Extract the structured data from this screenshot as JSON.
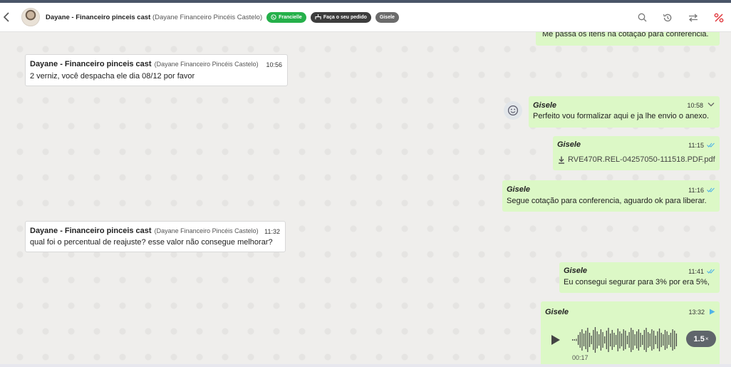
{
  "header": {
    "contact_name": "Dayane - Financeiro pinceis cast",
    "contact_sub": "(Dayane Financeiro Pincéis Castelo)",
    "tags": {
      "whatsapp": "Francielle",
      "order": "Faça o seu pedido",
      "agent": "Gisele"
    },
    "icons": [
      "search-icon",
      "history-icon",
      "transfer-icon",
      "percent-icon"
    ],
    "colors": {
      "whatsapp_tag": "#25b04a",
      "alert_icon": "#e0353b"
    }
  },
  "messages": {
    "m0": {
      "text": "Me passa os itens na cotação para conferencia."
    },
    "m1": {
      "sender": "Dayane - Financeiro pinceis cast",
      "sender_sub": "(Dayane Financeiro Pincéis Castelo)",
      "time": "10:56",
      "text": "2 verniz, você despacha ele dia 08/12 por favor"
    },
    "m2": {
      "sender": "Gisele",
      "time": "10:58",
      "text": "Perfeito vou formalizar aqui e ja lhe envio o anexo."
    },
    "m3": {
      "sender": "Gisele",
      "time": "11:15",
      "file": "RVE470R.REL-04257050-111518.PDF.pdf"
    },
    "m4": {
      "sender": "Gisele",
      "time": "11:16",
      "text": "Segue cotação para conferencia, aguardo ok para liberar."
    },
    "m5": {
      "sender": "Dayane - Financeiro pinceis cast",
      "sender_sub": "(Dayane Financeiro Pincéis Castelo)",
      "time": "11:32",
      "text": "qual foi o percentual de reajuste? esse valor não consegue melhorar?"
    },
    "m6": {
      "sender": "Gisele",
      "time": "11:41",
      "text": "Eu consegui segurar para 3% por era 5%,"
    },
    "m7": {
      "sender": "Gisele",
      "time": "13:32",
      "duration": "00:17",
      "speed": "1.5",
      "speed_unit": "×"
    }
  },
  "colors": {
    "outgoing_bubble": "#dcf8c6",
    "incoming_bubble": "#ffffff",
    "chat_background": "#efeeec",
    "read_ticks": "#4fb3e8"
  }
}
